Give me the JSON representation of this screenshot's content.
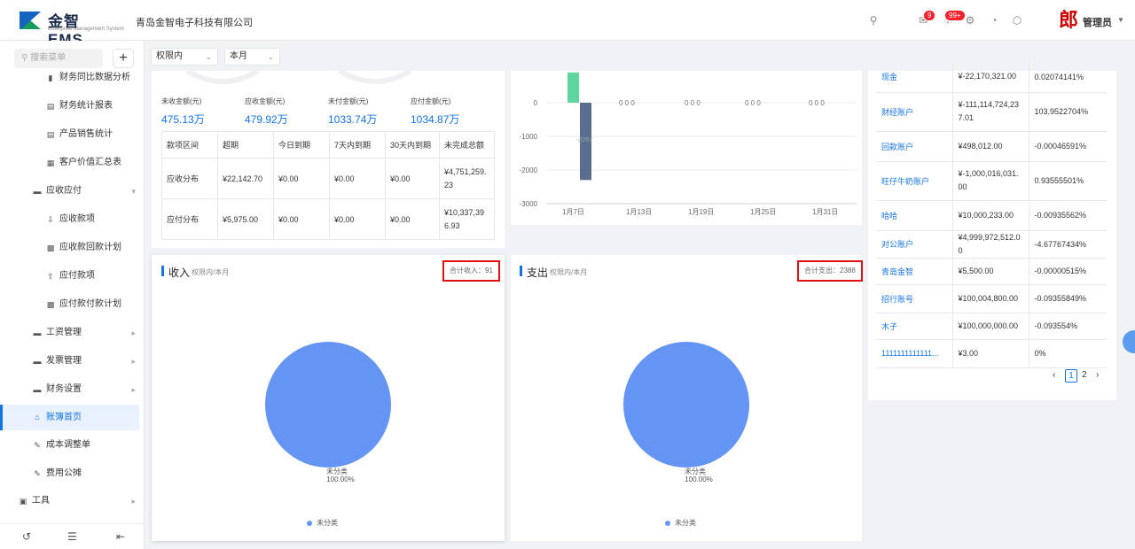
{
  "header": {
    "logo_title": "金智 EMS",
    "logo_sub": "Enterprise Management System",
    "company": "青岛金智电子科技有限公司",
    "badge_msg": "9",
    "badge_notice": "99+",
    "avatar_char": "郎",
    "user": "管理员"
  },
  "sidebar": {
    "search_placeholder": "搜索菜单",
    "items": [
      {
        "label": "财务同比数据分析"
      },
      {
        "label": "财务统计报表"
      },
      {
        "label": "产品销售统计"
      },
      {
        "label": "客户价值汇总表"
      },
      {
        "label": "应收应付"
      },
      {
        "label": "应收款项"
      },
      {
        "label": "应收款回款计划"
      },
      {
        "label": "应付款项"
      },
      {
        "label": "应付款付款计划"
      },
      {
        "label": "工资管理"
      },
      {
        "label": "发票管理"
      },
      {
        "label": "财务设置"
      },
      {
        "label": "账簿首页"
      },
      {
        "label": "成本调整单"
      },
      {
        "label": "费用公摊"
      },
      {
        "label": "工具"
      }
    ]
  },
  "filters": {
    "scope": "权限内",
    "period": "本月"
  },
  "stats": [
    {
      "label": "未收金额(元)",
      "value": "475.13万"
    },
    {
      "label": "应收金额(元)",
      "value": "479.92万"
    },
    {
      "label": "未付金额(元)",
      "value": "1033.74万"
    },
    {
      "label": "应付金额(元)",
      "value": "1034.87万"
    }
  ],
  "dist_table": {
    "headers": [
      "款项区间",
      "超期",
      "今日到期",
      "7天内到期",
      "30天内到期",
      "未完成总额"
    ],
    "rows": [
      [
        "应收分布",
        "¥22,142.70",
        "¥0.00",
        "¥0.00",
        "¥0.00",
        "¥4,751,259.23"
      ],
      [
        "应付分布",
        "¥5,975.00",
        "¥0.00",
        "¥0.00",
        "¥0.00",
        "¥10,337,396.93"
      ]
    ]
  },
  "chart_data": {
    "type": "bar",
    "y_ticks": [
      "0",
      "-1000",
      "-2000",
      "-3000"
    ],
    "x_ticks": [
      "1月7日",
      "1月13日",
      "1月19日",
      "1月25日",
      "1月31日"
    ],
    "ylim": [
      -3000,
      1000
    ],
    "series": [
      {
        "values": [
          900
        ]
      },
      {
        "values": [
          -2297
        ]
      }
    ],
    "data_labels": [
      "-2297"
    ],
    "colors": [
      "#5fd6a0",
      "#5b6d8e"
    ]
  },
  "accounts": [
    [
      "现金",
      "¥-22,170,321.00",
      "0.02074141%"
    ],
    [
      "财经账户",
      "¥-111,114,724,237.01",
      "103.9522704%"
    ],
    [
      "回款账户",
      "¥498,012.00",
      "-0.00046591%"
    ],
    [
      "旺仔牛奶账户",
      "¥-1,000,016,031.00",
      "0.93555501%"
    ],
    [
      "哈哈",
      "¥10,000,233.00",
      "-0.00935562%"
    ],
    [
      "对公账户",
      "¥4,999,972,512.00",
      "-4.67767434%"
    ],
    [
      "青岛金智",
      "¥5,500.00",
      "-0.00000515%"
    ],
    [
      "招行账号",
      "¥100,004,800.00",
      "-0.09355849%"
    ],
    [
      "木子",
      "¥100,000,000.00",
      "-0.093554%"
    ],
    [
      "1111111111111...",
      "¥3.00",
      "0%"
    ]
  ],
  "pager": {
    "pages": [
      "1",
      "2"
    ]
  },
  "income": {
    "title": "收入",
    "sub": "权限内/本月",
    "total": "合计收入：91",
    "slice": "未分类",
    "pct": "100.00%",
    "legend": "未分类"
  },
  "expense": {
    "title": "支出",
    "sub": "权限内/本月",
    "total": "合计支出：2388",
    "slice": "未分类",
    "pct": "100.00%",
    "legend": "未分类"
  }
}
